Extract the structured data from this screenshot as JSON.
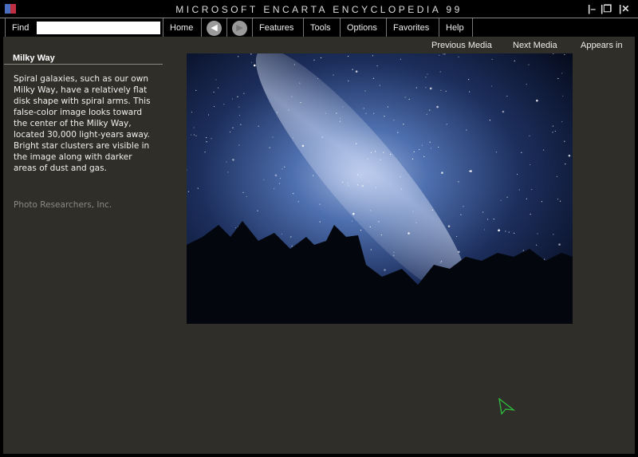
{
  "window": {
    "title": "MICROSOFT ENCARTA ENCYCLOPEDIA 99",
    "controls": [
      "minimize",
      "restore",
      "close"
    ]
  },
  "toolbar": {
    "find_label": "Find",
    "find_value": "",
    "home": "Home",
    "back_icon": "arrow-left-icon",
    "forward_icon": "arrow-right-icon",
    "features": "Features",
    "tools": "Tools",
    "options": "Options",
    "favorites": "Favorites",
    "help": "Help"
  },
  "media_nav": {
    "previous": "Previous Media",
    "next": "Next Media",
    "appears_in": "Appears in"
  },
  "media": {
    "title": "Milky Way",
    "caption": "Spiral galaxies, such as our own Milky Way, have a relatively flat disk shape with spiral arms. This false-color image looks toward the center of the Milky Way, located 30,000 light-years away. Bright star clusters are visible in the image along with darker areas of dust and gas.",
    "credit": "Photo Researchers, Inc."
  }
}
